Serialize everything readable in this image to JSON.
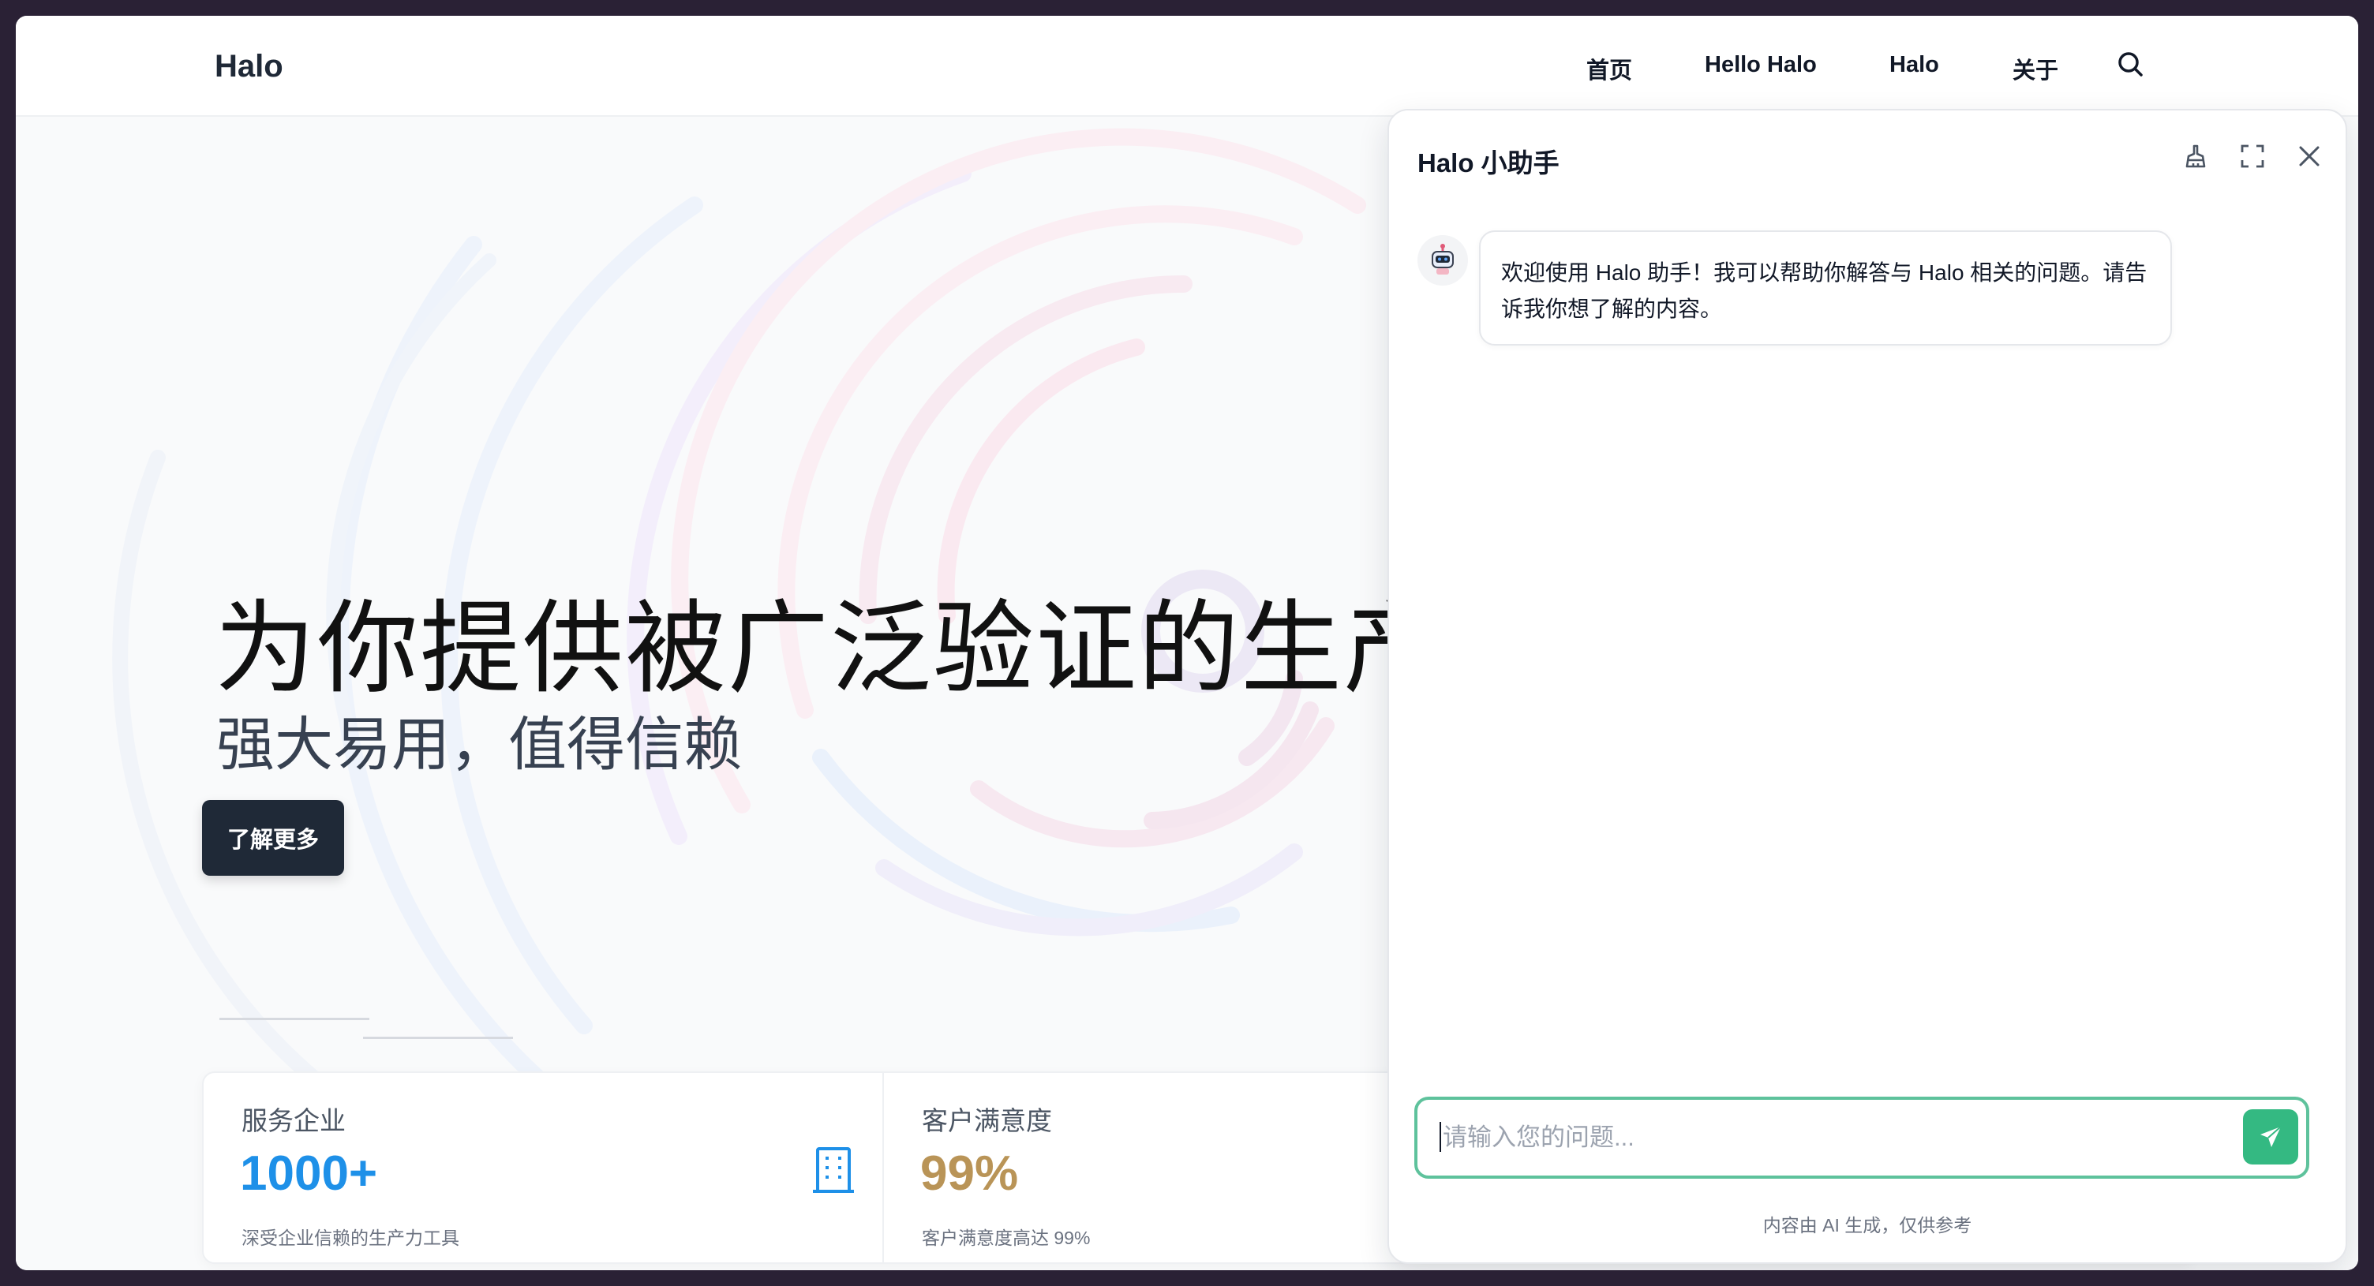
{
  "header": {
    "logo": "Halo",
    "nav": [
      "首页",
      "Hello Halo",
      "Halo",
      "关于"
    ]
  },
  "hero": {
    "title": "为你提供被广泛验证的生产力",
    "subtitle": "强大易用，值得信赖",
    "button_label": "了解更多"
  },
  "stats": [
    {
      "label": "服务企业",
      "value": "1000+",
      "desc": "深受企业信赖的生产力工具",
      "value_color": "#1e90e8",
      "icon": "building-icon"
    },
    {
      "label": "客户满意度",
      "value": "99%",
      "desc": "客户满意度高达 99%",
      "value_color": "#b99457",
      "icon": ""
    }
  ],
  "chat": {
    "title": "Halo 小助手",
    "tools": [
      "clean-icon",
      "fullscreen-icon",
      "close-icon"
    ],
    "welcome_line1": "欢迎使用 Halo 助手！我可以帮助你解答与 Halo 相关的问题。请告",
    "welcome_line2": "诉我你想了解的内容。",
    "input_placeholder": "请输入您的问题...",
    "input_value": "",
    "disclaimer": "内容由 AI 生成，仅供参考",
    "accent_color": "#34b982"
  }
}
